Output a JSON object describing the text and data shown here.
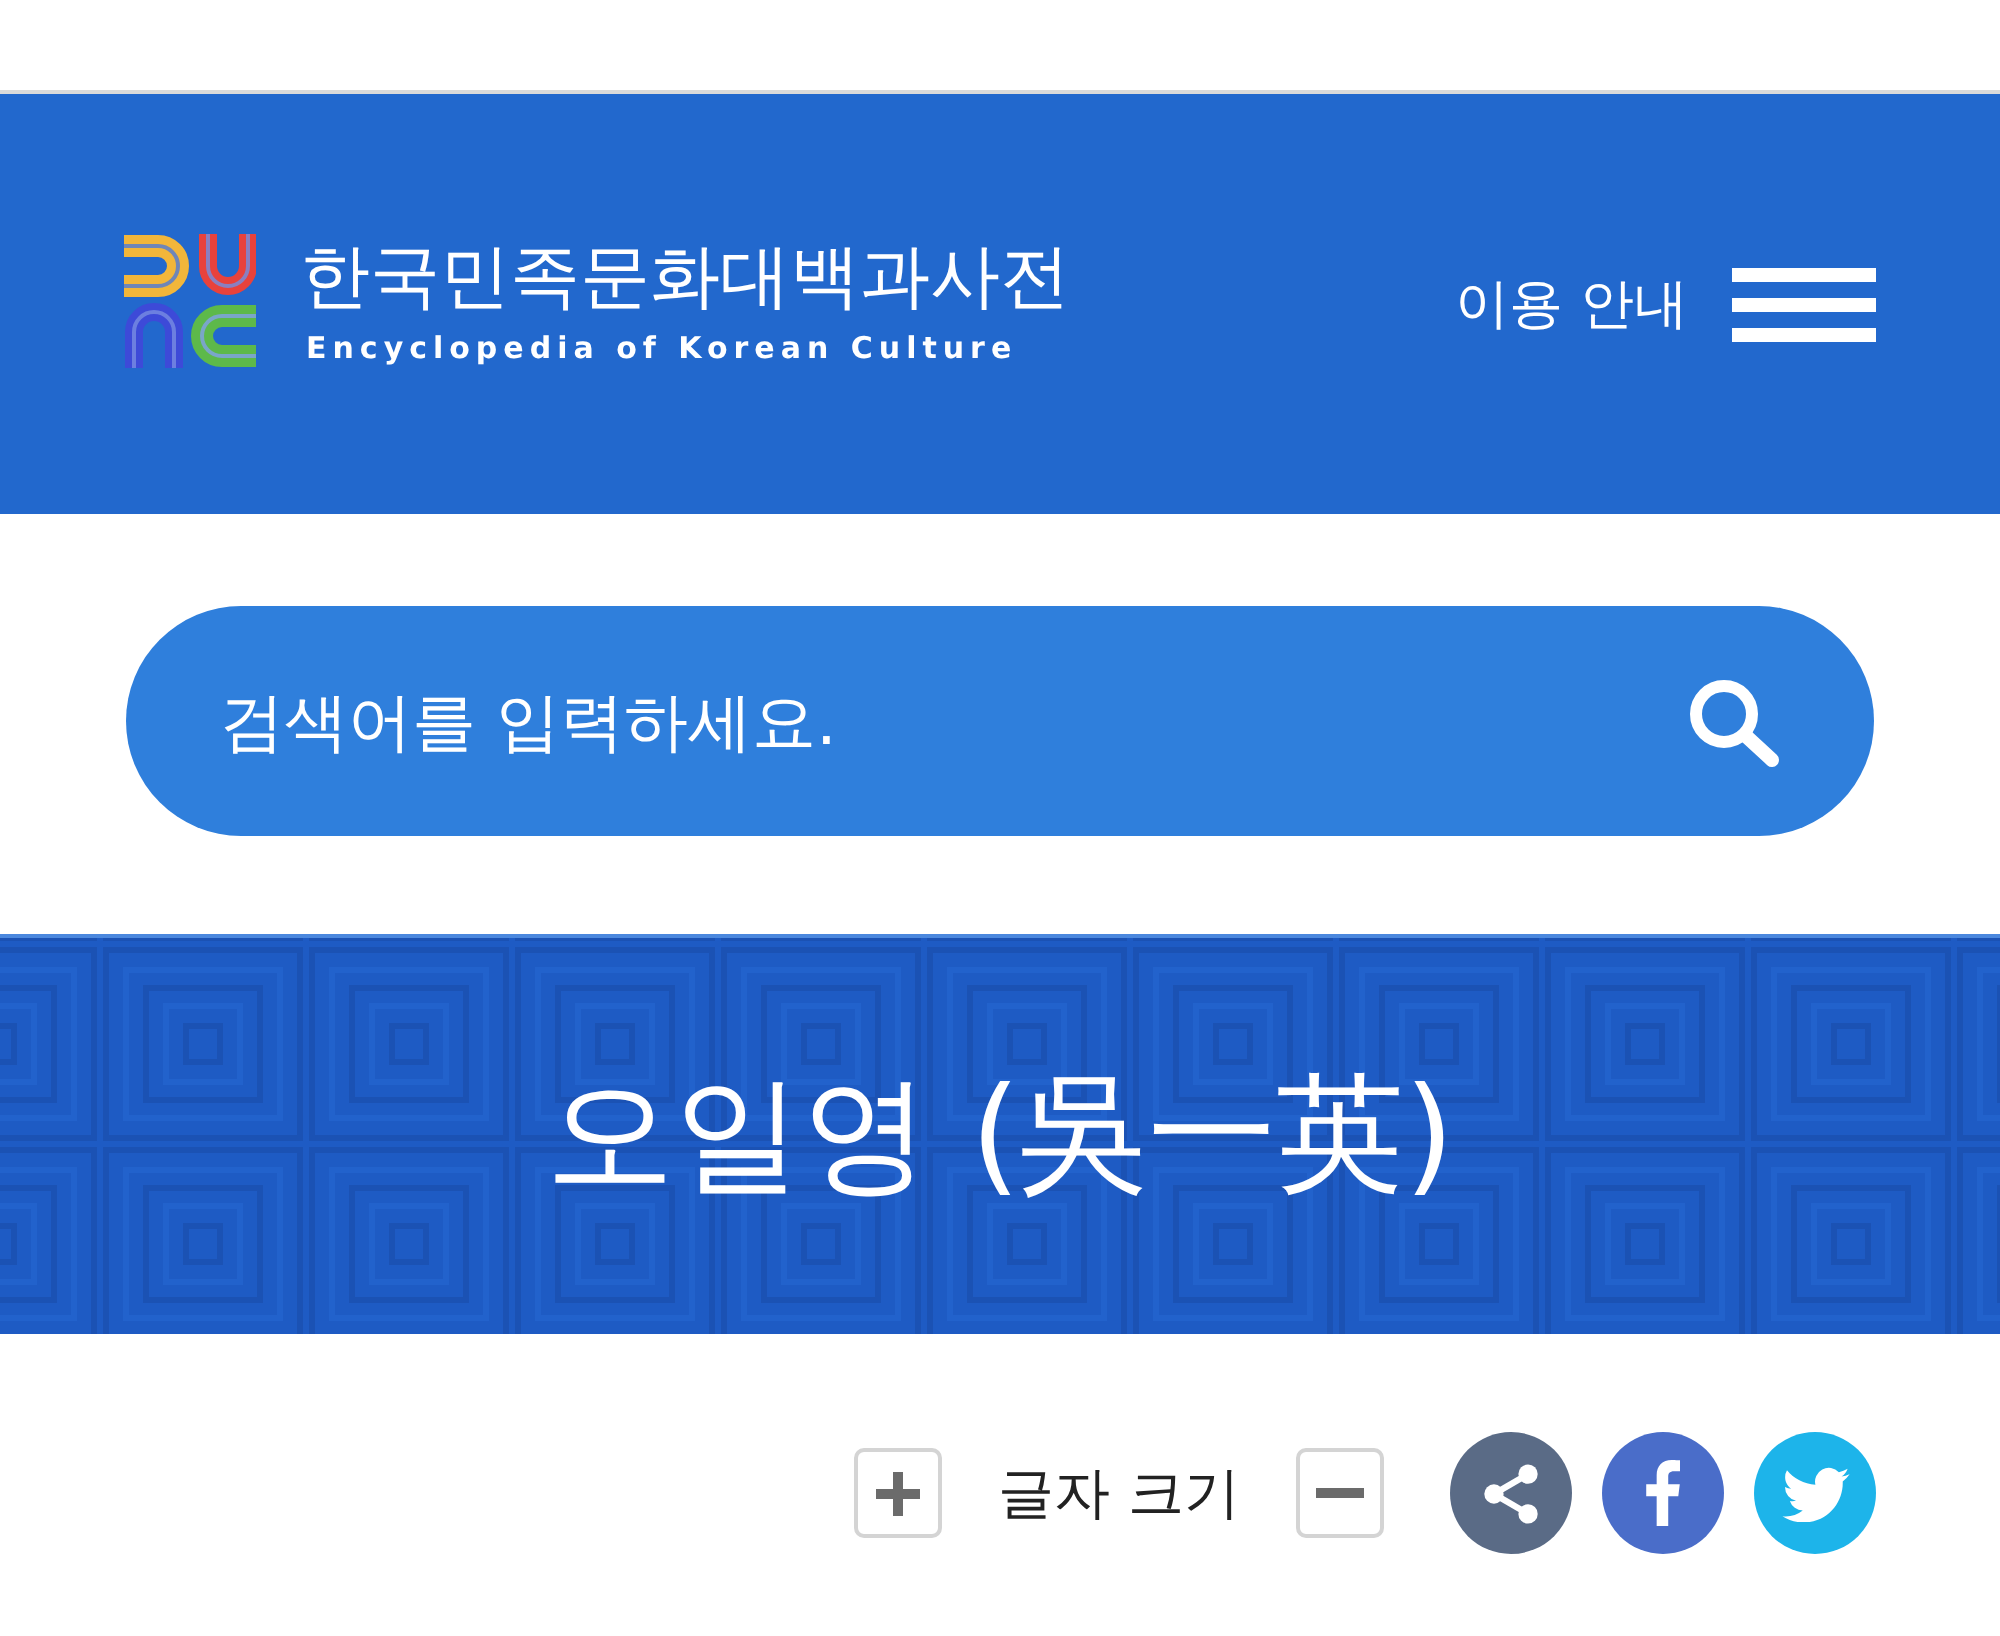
{
  "header": {
    "logo_title": "한국민족문화대백과사전",
    "logo_subtitle": "Encyclopedia of Korean Culture",
    "guide_link": "이용 안내"
  },
  "search": {
    "placeholder": "검색어를 입력하세요."
  },
  "article": {
    "title": "오일영 (吳一英)"
  },
  "toolbar": {
    "font_size_label": "글자 크기",
    "share_buttons": [
      {
        "kind": "share"
      },
      {
        "kind": "facebook"
      },
      {
        "kind": "twitter"
      }
    ]
  }
}
